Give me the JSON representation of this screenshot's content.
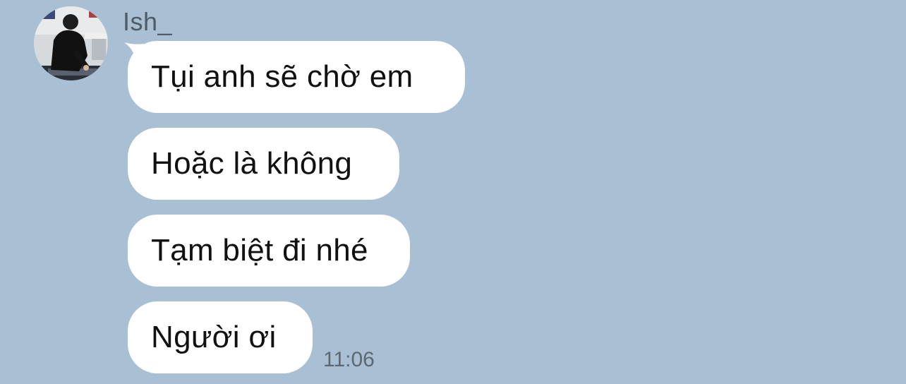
{
  "conversation": {
    "sender": {
      "name": "Ish_",
      "avatar_icon": "profile-photo"
    },
    "messages": [
      {
        "text": "Tụi anh sẽ chờ em"
      },
      {
        "text": "Hoặc là không"
      },
      {
        "text": "Tạm biệt đi nhé"
      },
      {
        "text": "Người ơi"
      }
    ],
    "timestamp": "11:06"
  },
  "colors": {
    "background": "#a9bfd3",
    "bubble": "#ffffff",
    "text": "#111111",
    "meta_text": "#5c6873"
  }
}
